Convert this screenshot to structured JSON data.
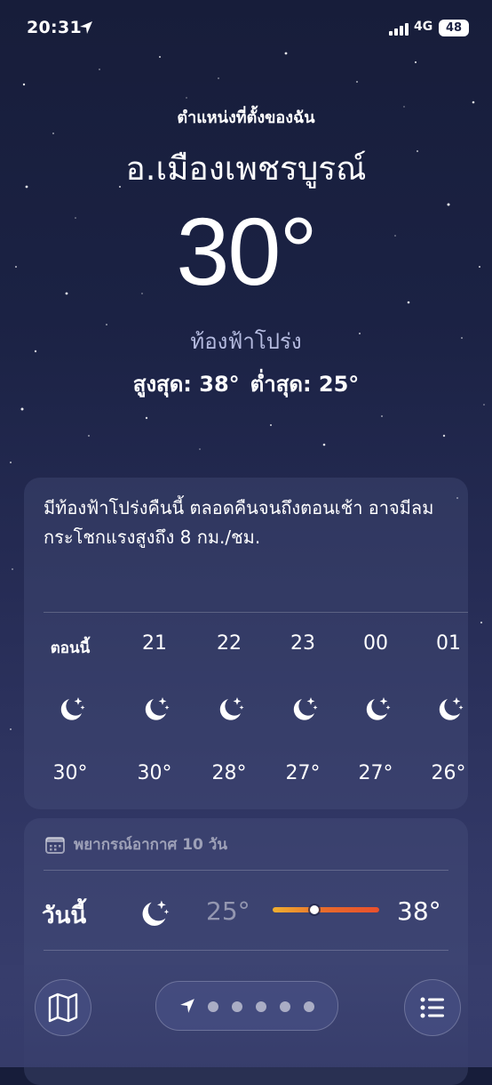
{
  "status_bar": {
    "time": "20:31",
    "network": "4G",
    "battery": "48"
  },
  "header": {
    "location_label": "ตำแหน่งที่ตั้งของฉัน",
    "city": "อ.เมืองเพชรบูรณ์",
    "temperature": "30°",
    "condition": "ท้องฟ้าโปร่ง",
    "high": "สูงสุด: 38°",
    "low": "ต่ำสุด: 25°"
  },
  "summary": {
    "text": "มีท้องฟ้าโปร่งคืนนี้ ตลอดคืนจนถึงตอนเช้า อาจมีลมกระโชกแรงสูงถึง 8 กม./ชม."
  },
  "hourly": [
    {
      "time": "ตอนนี้",
      "temp": "30°",
      "icon": "moon-stars-icon"
    },
    {
      "time": "21",
      "temp": "30°",
      "icon": "moon-stars-icon"
    },
    {
      "time": "22",
      "temp": "28°",
      "icon": "moon-stars-icon"
    },
    {
      "time": "23",
      "temp": "27°",
      "icon": "moon-stars-icon"
    },
    {
      "time": "00",
      "temp": "27°",
      "icon": "moon-stars-icon"
    },
    {
      "time": "01",
      "temp": "26°",
      "icon": "moon-stars-icon"
    }
  ],
  "forecast": {
    "header": "พยากรณ์อากาศ 10 วัน",
    "days": [
      {
        "day": "วันนี้",
        "icon": "moon-stars-icon",
        "low": "25°",
        "high": "38°",
        "current_fraction": 0.39
      }
    ]
  },
  "nav": {
    "page_count": 5,
    "current_page": 0
  },
  "colors": {
    "background_top": "#171d3a",
    "background_bottom": "#3a4070",
    "range_warm": "#e9502d",
    "range_yellow": "#f0b030"
  }
}
